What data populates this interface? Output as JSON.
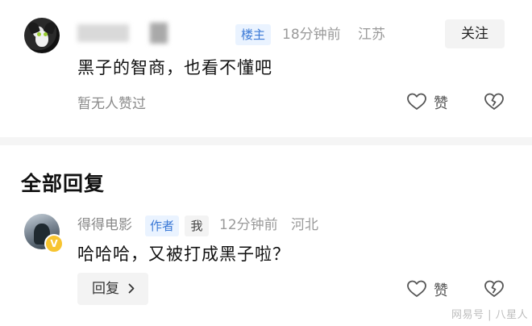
{
  "comment": {
    "badge": "楼主",
    "time": "18分钟前",
    "location": "江苏",
    "follow_label": "关注",
    "text": "黑子的智商，也看不懂吧",
    "likes_text": "暂无人赞过",
    "like_label": "赞"
  },
  "section_title": "全部回复",
  "reply": {
    "author": "得得电影",
    "author_badge": "作者",
    "me_badge": "我",
    "time": "12分钟前",
    "location": "河北",
    "text": "哈哈哈，又被打成黑子啦？",
    "reply_label": "回复",
    "like_label": "赞",
    "verified_mark": "V"
  },
  "watermark": "网易号 | 八星人",
  "icons": {
    "like": "heart-outline-icon",
    "dislike": "broken-heart-icon",
    "chevron": "chevron-right-icon"
  },
  "colors": {
    "accent": "#3b79d6",
    "badge_bg": "#eaf3ff",
    "verified": "#f7c430"
  }
}
